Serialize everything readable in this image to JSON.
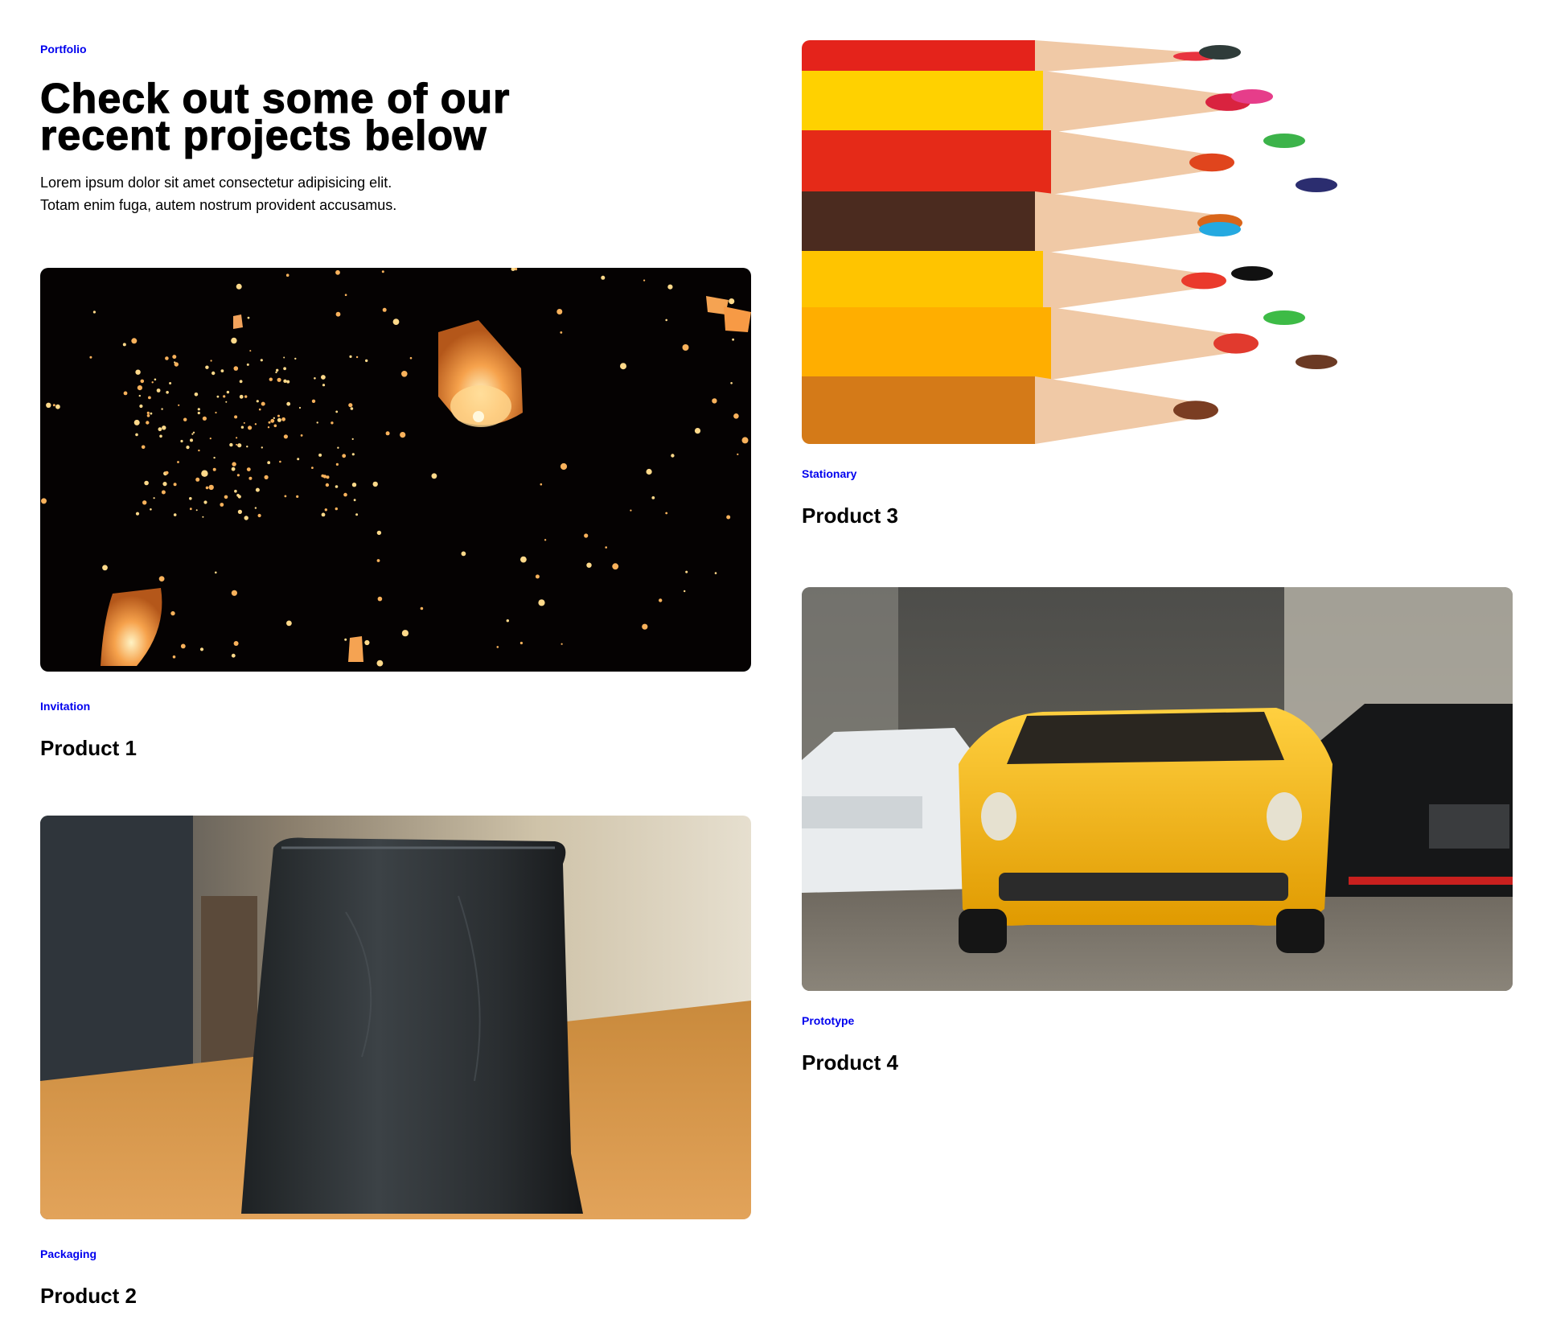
{
  "header": {
    "eyebrow": "Portfolio",
    "title_line1": "Check out some of our",
    "title_line2": "recent projects below",
    "desc_line1": "Lorem ipsum dolor sit amet consectetur adipisicing elit.",
    "desc_line2": "Totam enim fuga, autem nostrum provident accusamus."
  },
  "products": [
    {
      "category": "Invitation",
      "title": "Product 1",
      "image": "sky-lanterns-photo"
    },
    {
      "category": "Packaging",
      "title": "Product 2",
      "image": "coffee-pouch-photo"
    },
    {
      "category": "Stationary",
      "title": "Product 3",
      "image": "colored-pencils-photo"
    },
    {
      "category": "Prototype",
      "title": "Product 4",
      "image": "toy-cars-photo"
    }
  ],
  "colors": {
    "link": "#0000ee",
    "text": "#000000",
    "background": "#ffffff"
  }
}
